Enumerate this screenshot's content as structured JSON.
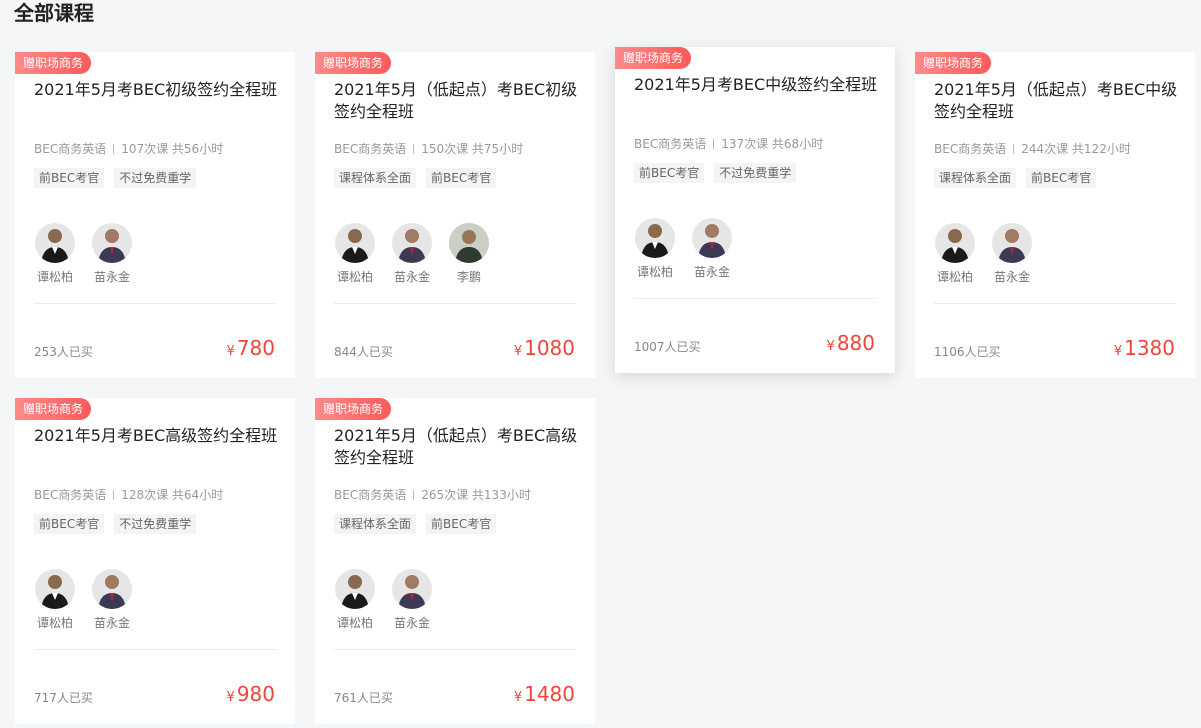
{
  "section": {
    "title": "全部课程"
  },
  "courses": [
    {
      "badge": "赠职场商务",
      "title": "2021年5月考BEC初级签约全程班",
      "category": "BEC商务英语",
      "lessons": "107次课 共56小时",
      "tags": [
        "前BEC考官",
        "不过免费重学"
      ],
      "teachers": [
        {
          "name": "谭松柏",
          "icon": "teacher-photo"
        },
        {
          "name": "苗永金",
          "icon": "teacher-photo"
        }
      ],
      "buyers": "253人已买",
      "currency": "¥",
      "price": "780"
    },
    {
      "badge": "赠职场商务",
      "title": "2021年5月（低起点）考BEC初级签约全程班",
      "category": "BEC商务英语",
      "lessons": "150次课 共75小时",
      "tags": [
        "课程体系全面",
        "前BEC考官"
      ],
      "teachers": [
        {
          "name": "谭松柏",
          "icon": "teacher-photo"
        },
        {
          "name": "苗永金",
          "icon": "teacher-photo"
        },
        {
          "name": "李鹏",
          "icon": "teacher-photo"
        }
      ],
      "buyers": "844人已买",
      "currency": "¥",
      "price": "1080"
    },
    {
      "badge": "赠职场商务",
      "title": "2021年5月考BEC中级签约全程班",
      "category": "BEC商务英语",
      "lessons": "137次课 共68小时",
      "tags": [
        "前BEC考官",
        "不过免费重学"
      ],
      "teachers": [
        {
          "name": "谭松柏",
          "icon": "teacher-photo"
        },
        {
          "name": "苗永金",
          "icon": "teacher-photo"
        }
      ],
      "buyers": "1007人已买",
      "currency": "¥",
      "price": "880"
    },
    {
      "badge": "赠职场商务",
      "title": "2021年5月（低起点）考BEC中级签约全程班",
      "category": "BEC商务英语",
      "lessons": "244次课 共122小时",
      "tags": [
        "课程体系全面",
        "前BEC考官"
      ],
      "teachers": [
        {
          "name": "谭松柏",
          "icon": "teacher-photo"
        },
        {
          "name": "苗永金",
          "icon": "teacher-photo"
        }
      ],
      "buyers": "1106人已买",
      "currency": "¥",
      "price": "1380"
    },
    {
      "badge": "赠职场商务",
      "title": "2021年5月考BEC高级签约全程班",
      "category": "BEC商务英语",
      "lessons": "128次课 共64小时",
      "tags": [
        "前BEC考官",
        "不过免费重学"
      ],
      "teachers": [
        {
          "name": "谭松柏",
          "icon": "teacher-photo"
        },
        {
          "name": "苗永金",
          "icon": "teacher-photo"
        }
      ],
      "buyers": "717人已买",
      "currency": "¥",
      "price": "980"
    },
    {
      "badge": "赠职场商务",
      "title": "2021年5月（低起点）考BEC高级签约全程班",
      "category": "BEC商务英语",
      "lessons": "265次课 共133小时",
      "tags": [
        "课程体系全面",
        "前BEC考官"
      ],
      "teachers": [
        {
          "name": "谭松柏",
          "icon": "teacher-photo"
        },
        {
          "name": "苗永金",
          "icon": "teacher-photo"
        }
      ],
      "buyers": "761人已买",
      "currency": "¥",
      "price": "1480"
    }
  ],
  "colors": {
    "accent": "#f0453b",
    "badge": "#fb5b5b",
    "background": "#f5f6f7"
  }
}
